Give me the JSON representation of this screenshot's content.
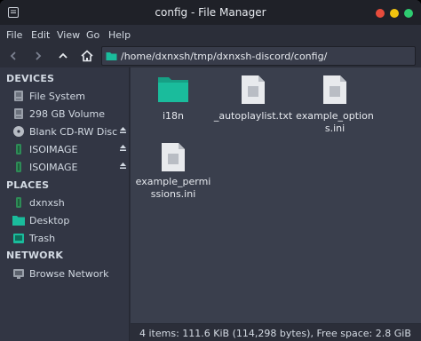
{
  "window": {
    "title": "config - File Manager"
  },
  "title_bar_buttons": {
    "close_color": "#e74c3c",
    "minimize_color": "#f1c40f",
    "maximize_color": "#2ecc71"
  },
  "menu": {
    "file": "File",
    "edit": "Edit",
    "view": "View",
    "go": "Go",
    "help": "Help"
  },
  "toolbar": {
    "path": "/home/dxnxsh/tmp/dxnxsh-discord/config/"
  },
  "sidebar": {
    "devices_header": "DEVICES",
    "devices": [
      {
        "label": "File System",
        "icon": "harddisk-icon"
      },
      {
        "label": "298 GB Volume",
        "icon": "harddisk-icon"
      },
      {
        "label": "Blank CD-RW Disc",
        "icon": "optical-disc-icon",
        "ejectable": true
      },
      {
        "label": "ISOIMAGE",
        "icon": "removable-drive-icon",
        "ejectable": true
      },
      {
        "label": "ISOIMAGE",
        "icon": "removable-drive-icon",
        "ejectable": true
      }
    ],
    "places_header": "PLACES",
    "places": [
      {
        "label": "dxnxsh",
        "icon": "home-folder-icon"
      },
      {
        "label": "Desktop",
        "icon": "desktop-folder-icon"
      },
      {
        "label": "Trash",
        "icon": "trash-icon"
      }
    ],
    "network_header": "NETWORK",
    "network": [
      {
        "label": "Browse Network",
        "icon": "network-icon"
      }
    ]
  },
  "files": [
    {
      "name": "i18n",
      "type": "folder"
    },
    {
      "name": "_autoplaylist.txt",
      "type": "document"
    },
    {
      "name": "example_options.ini",
      "type": "document"
    },
    {
      "name": "example_permissions.ini",
      "type": "document"
    }
  ],
  "accent_color": "#1abc9c",
  "status": {
    "text": "4 items: 111.6 KiB (114,298 bytes), Free space: 2.8 GiB"
  }
}
